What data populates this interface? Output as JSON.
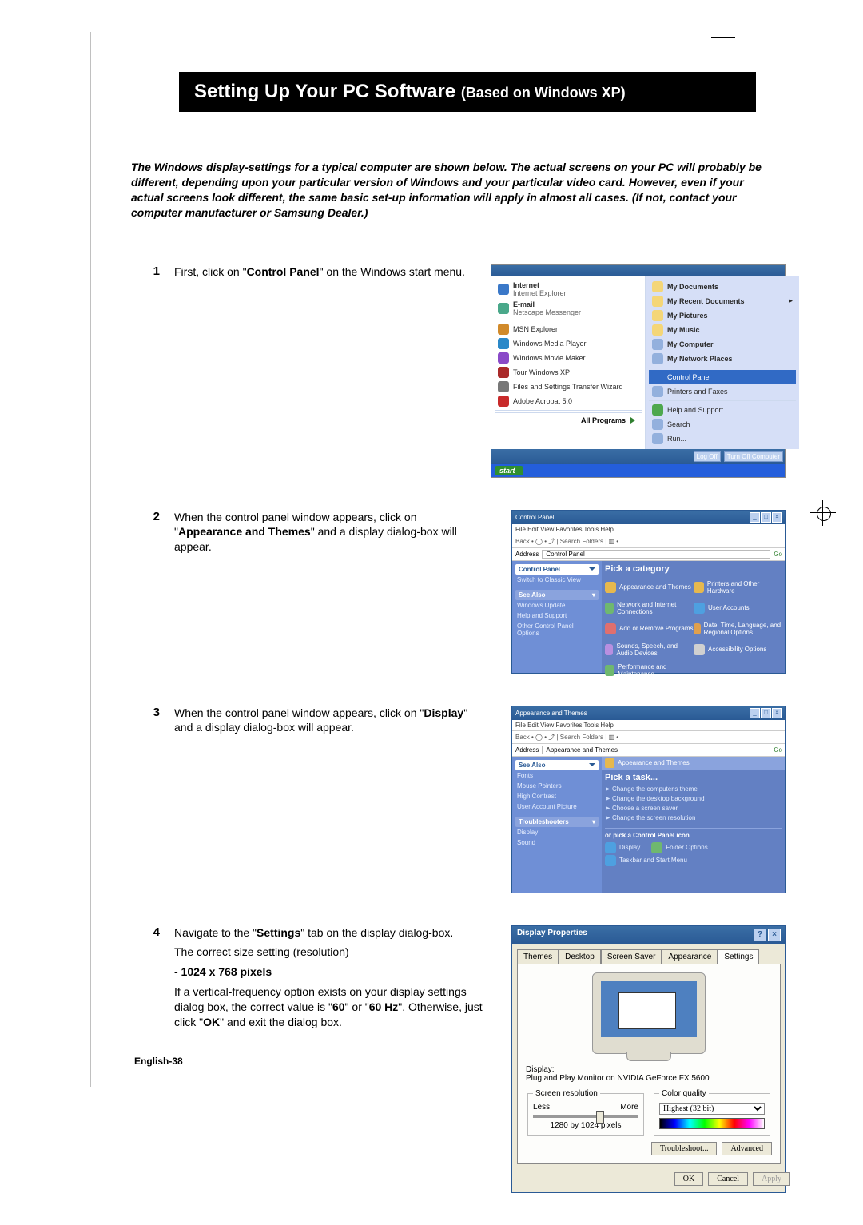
{
  "page": {
    "footer": "English-38",
    "title_main": "Setting Up Your PC Software ",
    "title_sub": "(Based on Windows XP)",
    "intro": "The Windows display-settings for a typical computer are shown below. The actual screens on your PC will probably be different, depending upon your particular version of Windows and your particular video card. However, even if your actual screens look different, the same basic set-up information will apply in almost all cases. (If not, contact your computer manufacturer or Samsung Dealer.)"
  },
  "steps": {
    "s1": {
      "n": "1",
      "pre": "First, click on \"",
      "bold": "Control Panel",
      "post": "\" on the Windows start menu."
    },
    "s2": {
      "n": "2",
      "pre": "When the control panel window appears, click on \"",
      "bold": "Appearance and Themes",
      "post": "\" and a display dialog-box will appear."
    },
    "s3": {
      "n": "3",
      "pre": "When the control panel window appears, click on \"",
      "bold": "Display",
      "post": "\" and a display dialog-box will appear."
    },
    "s4": {
      "n": "4",
      "l1a": "Navigate to the \"",
      "l1b": "Settings",
      "l1c": "\" tab on the display dialog-box.",
      "l2": "The correct size setting (resolution)",
      "l3": "- 1024 x 768 pixels",
      "l4a": "If a vertical-frequency option exists on your display settings dialog box, the correct value is \"",
      "l4b": "60",
      "l4c": "\" or \"",
      "l4d": "60 Hz",
      "l4e": "\". Otherwise, just click \"",
      "l4f": "OK",
      "l4g": "\" and exit the dialog box."
    }
  },
  "startmenu": {
    "left": {
      "internet_t": "Internet",
      "internet_s": "Internet Explorer",
      "email_t": "E-mail",
      "email_s": "Netscape Messenger",
      "msn": "MSN Explorer",
      "wmp": "Windows Media Player",
      "mm": "Windows Movie Maker",
      "tour": "Tour Windows XP",
      "fst": "Files and Settings Transfer Wizard",
      "acro": "Adobe Acrobat 5.0",
      "allprog": "All Programs"
    },
    "right": {
      "docs": "My Documents",
      "recent": "My Recent Documents",
      "pics": "My Pictures",
      "music": "My Music",
      "comp": "My Computer",
      "net": "My Network Places",
      "cp": "Control Panel",
      "printers": "Printers and Faxes",
      "help": "Help and Support",
      "search": "Search",
      "run": "Run..."
    },
    "logoff": "Log Off",
    "turnoff": "Turn Off Computer",
    "start": "start"
  },
  "cp": {
    "title": "Control Panel",
    "menu": "File   Edit   View   Favorites   Tools   Help",
    "tool": "Back  •  ◯  •  ⤴  |  Search   Folders   | ▥ •",
    "addr_lbl": "Address",
    "addr_val": "Control Panel",
    "go": "Go",
    "side_hd": "Control Panel",
    "side_switch": "Switch to Classic View",
    "side_see": "See Also",
    "side_link1": "Windows Update",
    "side_link2": "Help and Support",
    "side_link3": "Other Control Panel Options",
    "pick": "Pick a category",
    "cats": {
      "c1": "Appearance and Themes",
      "c2": "Printers and Other Hardware",
      "c3": "Network and Internet Connections",
      "c4": "User Accounts",
      "c5": "Add or Remove Programs",
      "c6": "Date, Time, Language, and Regional Options",
      "c7": "Sounds, Speech, and Audio Devices",
      "c8": "Accessibility Options",
      "c9": "Performance and Maintenance"
    }
  },
  "appthemes": {
    "title": "Appearance and Themes",
    "menu": "File   Edit   View   Favorites   Tools   Help",
    "tool": "Back  •  ◯  •  ⤴  |  Search   Folders   | ▥ •",
    "addr_lbl": "Address",
    "addr_val": "Appearance and Themes",
    "go": "Go",
    "side_hd": "See Also",
    "side_l1": "Fonts",
    "side_l2": "Mouse Pointers",
    "side_l3": "High Contrast",
    "side_l4": "User Account Picture",
    "side_hd2": "Troubleshooters",
    "side_l5": "Display",
    "side_l6": "Sound",
    "heading_icon": "Appearance and Themes",
    "pick": "Pick a task...",
    "t1": "Change the computer's theme",
    "t2": "Change the desktop background",
    "t3": "Choose a screen saver",
    "t4": "Change the screen resolution",
    "sub": "or pick a Control Panel icon",
    "ic1": "Display",
    "ic2": "Folder Options",
    "ic3": "Taskbar and Start Menu"
  },
  "dp": {
    "title": "Display Properties",
    "tabs": {
      "themes": "Themes",
      "desktop": "Desktop",
      "ss": "Screen Saver",
      "appearance": "Appearance",
      "settings": "Settings"
    },
    "display_lbl": "Display:",
    "display_val": "Plug and Play Monitor on NVIDIA GeForce FX 5600",
    "sr_legend": "Screen resolution",
    "sr_less": "Less",
    "sr_more": "More",
    "sr_val": "1280 by 1024 pixels",
    "cq_legend": "Color quality",
    "cq_val": "Highest (32 bit)",
    "btn_trouble": "Troubleshoot...",
    "btn_adv": "Advanced",
    "btn_ok": "OK",
    "btn_cancel": "Cancel",
    "btn_apply": "Apply"
  }
}
